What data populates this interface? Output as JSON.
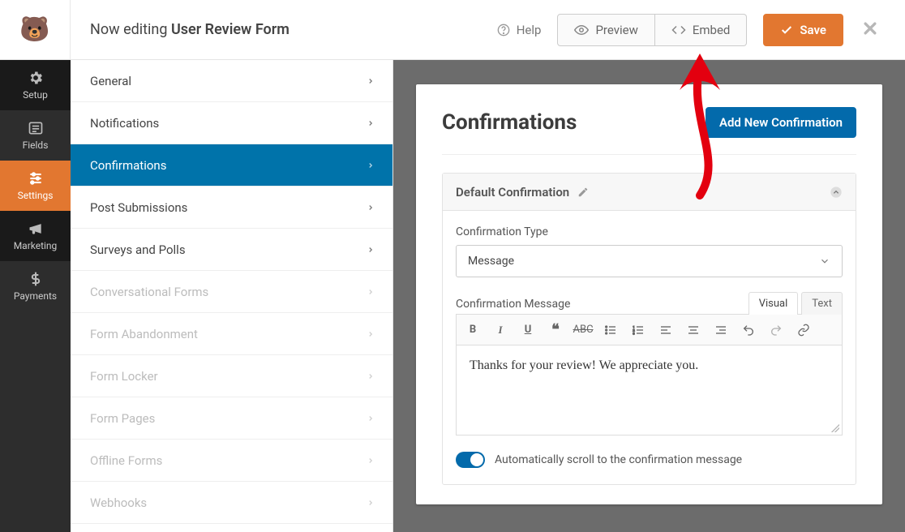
{
  "topbar": {
    "editing_prefix": "Now editing",
    "form_name": "User Review Form",
    "help_label": "Help",
    "preview_label": "Preview",
    "embed_label": "Embed",
    "save_label": "Save"
  },
  "rail": {
    "items": [
      {
        "label": "Setup"
      },
      {
        "label": "Fields"
      },
      {
        "label": "Settings"
      },
      {
        "label": "Marketing"
      },
      {
        "label": "Payments"
      }
    ]
  },
  "sidebar": {
    "items": [
      {
        "label": "General"
      },
      {
        "label": "Notifications"
      },
      {
        "label": "Confirmations"
      },
      {
        "label": "Post Submissions"
      },
      {
        "label": "Surveys and Polls"
      },
      {
        "label": "Conversational Forms"
      },
      {
        "label": "Form Abandonment"
      },
      {
        "label": "Form Locker"
      },
      {
        "label": "Form Pages"
      },
      {
        "label": "Offline Forms"
      },
      {
        "label": "Webhooks"
      }
    ]
  },
  "main": {
    "heading": "Confirmations",
    "add_button": "Add New Confirmation",
    "panel_title": "Default Confirmation",
    "confirmation_type_label": "Confirmation Type",
    "confirmation_type_value": "Message",
    "confirmation_message_label": "Confirmation Message",
    "tabs": {
      "visual": "Visual",
      "text": "Text"
    },
    "message": "Thanks for your review! We appreciate you.",
    "toggle_label": "Automatically scroll to the confirmation message"
  }
}
